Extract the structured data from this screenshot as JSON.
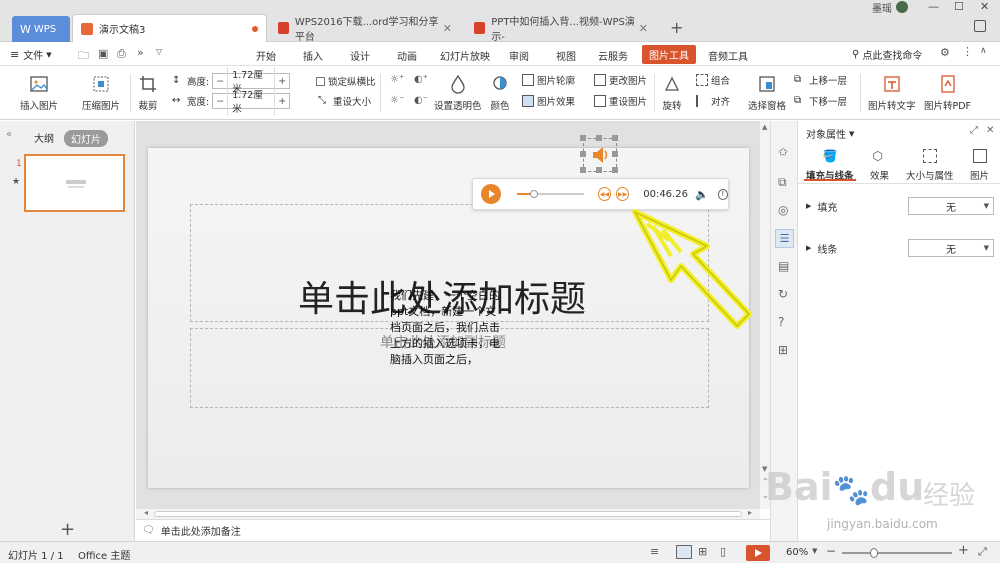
{
  "titlebar": {
    "tabs": [
      {
        "label": "WPS"
      },
      {
        "label": "演示文稿3"
      },
      {
        "label": "WPS2016下载...ord学习和分享平台"
      },
      {
        "label": "PPT中如何插入背...视频-WPS演示-"
      }
    ],
    "user_name": "墨瑶",
    "colors": {
      "wps_blue": "#5b8dd9",
      "accent_orange": "#d9542c"
    }
  },
  "menu": {
    "file": "文件",
    "items": [
      "开始",
      "插入",
      "设计",
      "动画",
      "幻灯片放映",
      "审阅",
      "视图",
      "云服务",
      "图片工具",
      "音频工具"
    ],
    "active": "图片工具",
    "search_placeholder": "点此查找命令"
  },
  "ribbon": {
    "insert_picture": "插入图片",
    "compress_picture": "压缩图片",
    "crop": "裁剪",
    "height_label": "高度:",
    "height_value": "1.72厘米",
    "width_label": "宽度:",
    "width_value": "1.72厘米",
    "lock_ratio": "锁定纵横比",
    "reset_size": "重设大小",
    "set_transparent": "设置透明色",
    "color": "颜色",
    "picture_outline": "图片轮廓",
    "picture_effect": "图片效果",
    "change_picture": "更改图片",
    "reset_picture": "重设图片",
    "rotate": "旋转",
    "group": "组合",
    "align": "对齐",
    "select_pane": "选择窗格",
    "bring_forward": "上移一层",
    "send_backward": "下移一层",
    "pic_to_text": "图片转文字",
    "pic_to_pdf": "图片转PDF"
  },
  "left_panel": {
    "tab_outline": "大纲",
    "tab_slides": "幻灯片",
    "slide_number": "1",
    "star": "★"
  },
  "slide": {
    "title_placeholder": "单击此处添加标题",
    "subtitle_placeholder": "单击此处添加副标题",
    "overlay_lines": [
      "我们先建，一个空白的",
      "ppt文档，新建一个文",
      "档页面之后，我们点击",
      "上方的插入选项卡，电",
      "脑插入页面之后，"
    ]
  },
  "audio_player": {
    "time": "00:46.26",
    "progress": 0.25
  },
  "notes": {
    "placeholder": "单击此处添加备注"
  },
  "props_panel": {
    "title": "对象属性",
    "tabs": [
      "填充与线条",
      "效果",
      "大小与属性",
      "图片"
    ],
    "fill_label": "填充",
    "fill_value": "无",
    "line_label": "线条",
    "line_value": "无"
  },
  "status": {
    "slide_info": "幻灯片 1 / 1",
    "theme": "Office 主题",
    "zoom": "60%"
  },
  "watermark": {
    "brand": "Bai",
    "brand2": "du",
    "cn": "经验",
    "url": "jingyan.baidu.com"
  }
}
